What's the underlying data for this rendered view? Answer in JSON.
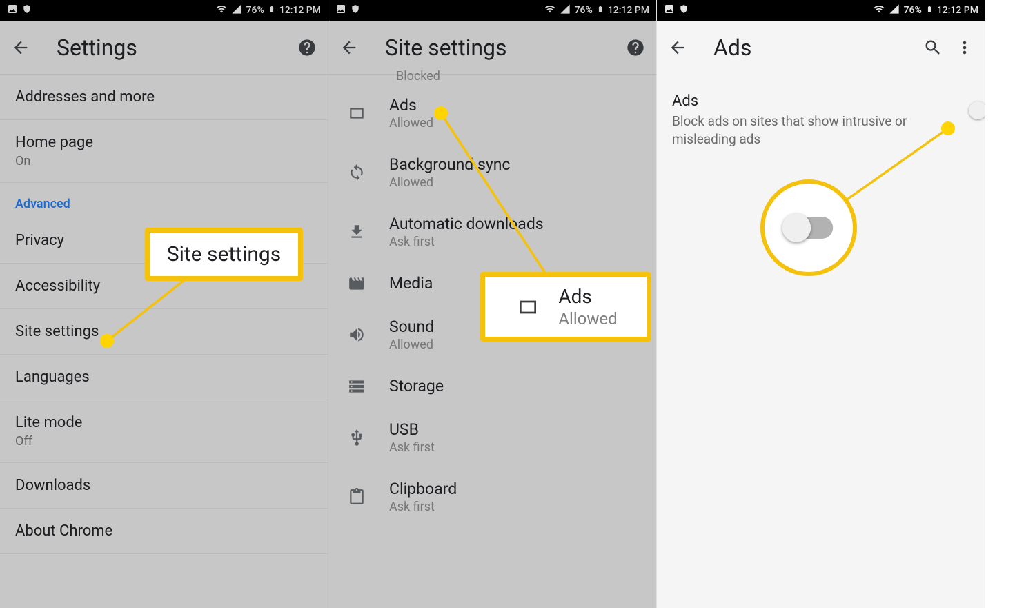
{
  "status": {
    "battery_pct": "76%",
    "time": "12:12 PM"
  },
  "screen1": {
    "title": "Settings",
    "items": {
      "addresses": {
        "label": "Addresses and more"
      },
      "homepage": {
        "label": "Home page",
        "sub": "On"
      },
      "section": "Advanced",
      "privacy": {
        "label": "Privacy"
      },
      "accessibility": {
        "label": "Accessibility"
      },
      "site_settings": {
        "label": "Site settings"
      },
      "languages": {
        "label": "Languages"
      },
      "lite_mode": {
        "label": "Lite mode",
        "sub": "Off"
      },
      "downloads": {
        "label": "Downloads"
      },
      "about": {
        "label": "About Chrome"
      }
    },
    "callout": "Site settings"
  },
  "screen2": {
    "title": "Site settings",
    "blocked_peek": "Blocked",
    "rows": {
      "ads": {
        "label": "Ads",
        "sub": "Allowed"
      },
      "bgsync": {
        "label": "Background sync",
        "sub": "Allowed"
      },
      "auto_dl": {
        "label": "Automatic downloads",
        "sub": "Ask first"
      },
      "media": {
        "label": "Media"
      },
      "sound": {
        "label": "Sound",
        "sub": "Allowed"
      },
      "storage": {
        "label": "Storage"
      },
      "usb": {
        "label": "USB",
        "sub": "Ask first"
      },
      "clipboard": {
        "label": "Clipboard",
        "sub": "Ask first"
      }
    },
    "callout": {
      "label": "Ads",
      "sub": "Allowed"
    }
  },
  "screen3": {
    "title": "Ads",
    "item": {
      "label": "Ads",
      "sub": "Block ads on sites that show intrusive or misleading ads"
    }
  }
}
